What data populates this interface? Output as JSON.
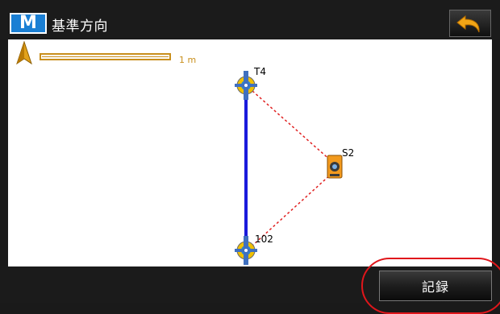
{
  "header": {
    "logo_letter": "M",
    "title": "基準方向",
    "back_icon": "undo-arrow-icon"
  },
  "map": {
    "north_marker": "N",
    "scale_label": "1 m",
    "points": [
      {
        "name": "T4",
        "icon": "target-prism-icon"
      },
      {
        "name": "S2",
        "icon": "total-station-icon"
      },
      {
        "name": "102",
        "icon": "target-prism-icon"
      }
    ]
  },
  "footer": {
    "record_label": "記録"
  },
  "colors": {
    "accent_blue": "#1a7fd4",
    "baseline_blue": "#1a1adc",
    "sight_line_red": "#e02020",
    "scale_orange": "#c98f1c",
    "highlight_red": "#e0161b"
  }
}
